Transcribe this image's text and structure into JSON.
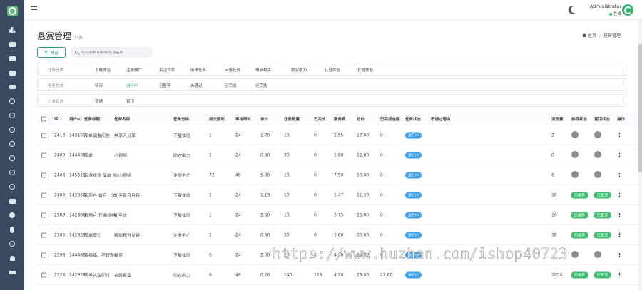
{
  "topbar": {
    "user_name": "Administrator",
    "user_status": "在线"
  },
  "page": {
    "title": "悬赏管理",
    "subtitle": "列表"
  },
  "breadcrumb": {
    "home": "主页",
    "current": "悬赏管理"
  },
  "toolbar": {
    "filter_label": "筛选",
    "search_placeholder": "可以搜索ID/标题/任务名称"
  },
  "filters": {
    "category": {
      "label": "任务分类",
      "options": [
        "下载体验",
        "注册推广",
        "关注转发",
        "简单任务",
        "问卷任务",
        "电商相关",
        "助农助力",
        "认证体验",
        "其他体验"
      ]
    },
    "status": {
      "label": "任务状态",
      "options": [
        "待审",
        "进行中",
        "已暂停",
        "未通过",
        "已完成",
        "已完结"
      ]
    },
    "order": {
      "label": "订单状态",
      "options": [
        "普通",
        "置顶"
      ]
    }
  },
  "table": {
    "columns": [
      "ID",
      "用户ID",
      "任务标题",
      "任务名称",
      "任务分类",
      "提交限时",
      "审核限时",
      "单价",
      "任务数量",
      "已完成",
      "服务费",
      "总价",
      "已完成金额",
      "任务状态",
      "不通过理由",
      "浏览量",
      "推荐状态",
      "置顶状态",
      "操作"
    ],
    "rows": [
      {
        "id": "2413",
        "uid": "143160",
        "title": "简单调查问卷",
        "name": "共享人分享",
        "cat": "下载体验",
        "submit": "1",
        "review": "24",
        "price": "1.70",
        "qty": "10",
        "done": "0",
        "fee": "2.55",
        "total": "17.00",
        "done_amt": "0",
        "status": "进行中",
        "reason": "",
        "views": "2",
        "rec": "",
        "top": ""
      },
      {
        "id": "2409",
        "uid": "144406",
        "title": "简单",
        "name": "小视频",
        "cat": "助农助力",
        "submit": "1",
        "review": "24",
        "price": "0.40",
        "qty": "30",
        "done": "0",
        "fee": "1.80",
        "total": "12.00",
        "done_amt": "0",
        "status": "进行中",
        "reason": "",
        "views": "0",
        "rec": "",
        "top": ""
      },
      {
        "id": "2408",
        "uid": "145618",
        "title": "玩游戏领 简单 附",
        "name": "火山视频",
        "cat": "注册推广",
        "submit": "72",
        "review": "48",
        "price": "5.00",
        "qty": "10",
        "done": "0",
        "fee": "7.50",
        "total": "50.00",
        "done_amt": "0",
        "status": "进行中",
        "reason": "",
        "views": "6",
        "rec": "",
        "top": ""
      },
      {
        "id": "2403",
        "uid": "142866",
        "title": "新用户 首月一次",
        "name": "知乎新月月租",
        "cat": "下载体验",
        "submit": "1",
        "review": "24",
        "price": "1.13",
        "qty": "10",
        "done": "0",
        "fee": "1.47",
        "total": "11.30",
        "done_amt": "0",
        "status": "进行中",
        "reason": "",
        "views": "16",
        "rec": "已推荐",
        "top": "已置顶"
      },
      {
        "id": "2389",
        "uid": "142866",
        "title": "新用户 开通领券",
        "name": "知乎送",
        "cat": "下载体验",
        "submit": "1",
        "review": "24",
        "price": "2.50",
        "qty": "10",
        "done": "0",
        "fee": "3.75",
        "total": "25.00",
        "done_amt": "0",
        "status": "进行中",
        "reason": "",
        "views": "16",
        "rec": "已推荐",
        "top": "已置顶"
      },
      {
        "id": "2385",
        "uid": "142859",
        "title": "简单帮忙",
        "name": "移动积分兑换",
        "cat": "注册推广",
        "submit": "1",
        "review": "24",
        "price": "0.60",
        "qty": "50",
        "done": "0",
        "fee": "3.60",
        "total": "30.00",
        "done_amt": "0",
        "status": "进行中",
        "reason": "",
        "views": "38",
        "rec": "已推荐",
        "top": "已置顶"
      },
      {
        "id": "2298",
        "uid": "144486",
        "title": "搞搞搞，不玩游戏",
        "name": "创意",
        "cat": "下载体验",
        "submit": "6",
        "review": "24",
        "price": "2.00",
        "qty": "10",
        "done": "0",
        "fee": "4.00",
        "total": "26.00",
        "done_amt": "0",
        "status": "进行中",
        "reason": "",
        "views": "",
        "rec": "",
        "top": ""
      },
      {
        "id": "2224",
        "uid": "142928",
        "title": "简单关注即过",
        "name": "农民餐盒",
        "cat": "助农助力",
        "submit": "6",
        "review": "48",
        "price": "0.20",
        "qty": "140",
        "done": "118",
        "fee": "4.20",
        "total": "28.00",
        "done_amt": "23.60",
        "status": "进行中",
        "reason": "",
        "views": "1654",
        "rec": "已推荐",
        "top": "已置顶"
      }
    ]
  },
  "watermark": "https://www.huzhan.com/ishop40723"
}
